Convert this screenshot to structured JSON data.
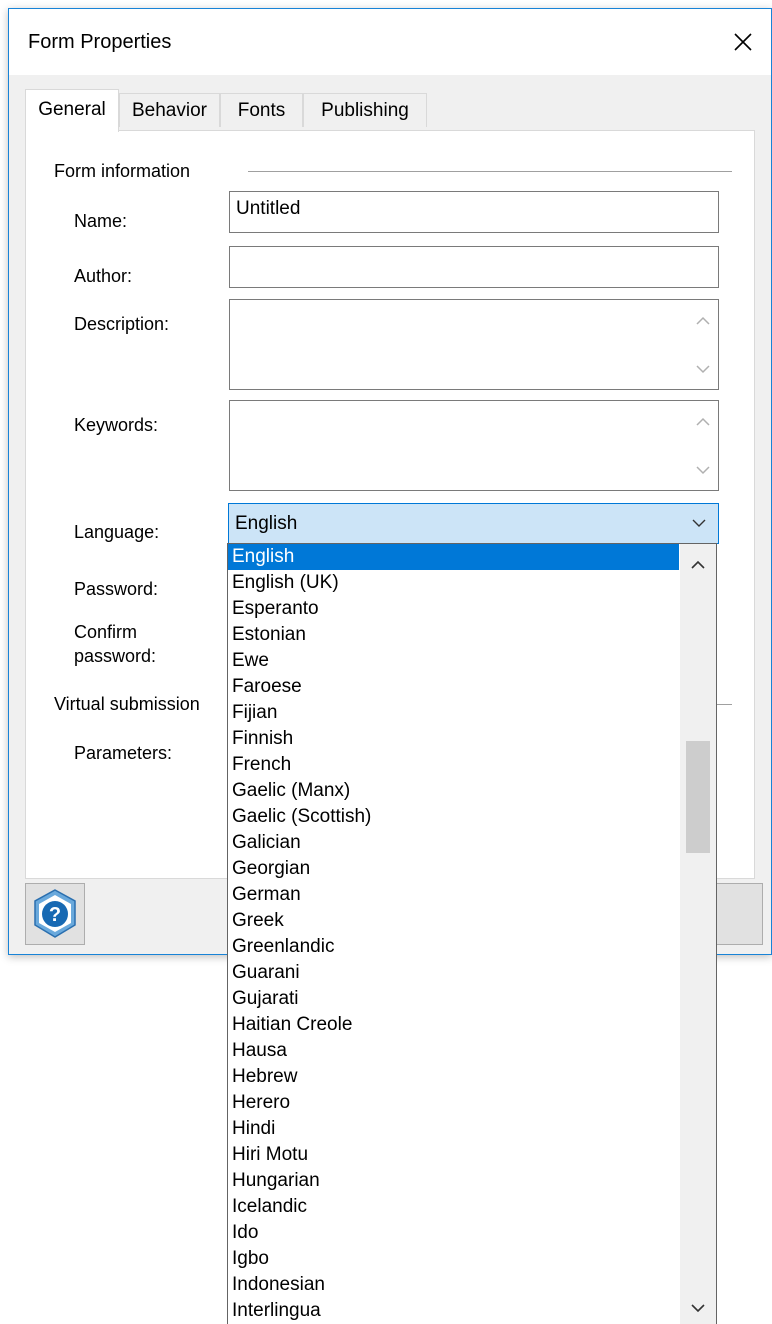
{
  "window": {
    "title": "Form Properties"
  },
  "tabs": [
    {
      "label": "General"
    },
    {
      "label": "Behavior"
    },
    {
      "label": "Fonts"
    },
    {
      "label": "Publishing"
    }
  ],
  "form_information": {
    "group_label": "Form information",
    "name_label": "Name:",
    "name_value": "Untitled",
    "author_label": "Author:",
    "author_value": "",
    "description_label": "Description:",
    "keywords_label": "Keywords:",
    "language_label": "Language:",
    "language_value": "English",
    "password_label": "Password:",
    "confirm_password_label_line1": "Confirm",
    "confirm_password_label_line2": "password:"
  },
  "virtual_submission": {
    "group_label": "Virtual submission",
    "parameters_label": "Parameters:"
  },
  "language_dropdown": {
    "selected": "English",
    "options": [
      "English",
      "English (UK)",
      "Esperanto",
      "Estonian",
      "Ewe",
      "Faroese",
      "Fijian",
      "Finnish",
      "French",
      "Gaelic (Manx)",
      "Gaelic (Scottish)",
      "Galician",
      "Georgian",
      "German",
      "Greek",
      "Greenlandic",
      "Guarani",
      "Gujarati",
      "Haitian Creole",
      "Hausa",
      "Hebrew",
      "Herero",
      "Hindi",
      "Hiri Motu",
      "Hungarian",
      "Icelandic",
      "Ido",
      "Igbo",
      "Indonesian",
      "Interlingua"
    ]
  },
  "icons": {
    "close": "close-icon",
    "help": "help-icon",
    "dropdown": "chevron-down-icon"
  },
  "colors": {
    "accent": "#0078d7",
    "window_border": "#1883d7",
    "help_icon_fill": "#1769b3"
  }
}
